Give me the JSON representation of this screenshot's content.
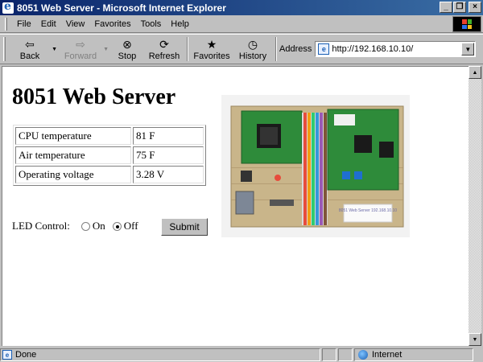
{
  "window": {
    "title": "8051 Web Server - Microsoft Internet Explorer",
    "minimize": "_",
    "restore": "❐",
    "close": "×"
  },
  "menu": {
    "file": "File",
    "edit": "Edit",
    "view": "View",
    "favorites": "Favorites",
    "tools": "Tools",
    "help": "Help"
  },
  "toolbar": {
    "back": "Back",
    "forward": "Forward",
    "stop": "Stop",
    "refresh": "Refresh",
    "favorites": "Favorites",
    "history": "History",
    "address_label": "Address",
    "url": "http://192.168.10.10/"
  },
  "page": {
    "title": "8051 Web Server",
    "readings": [
      {
        "label": "CPU temperature",
        "value": "81 F"
      },
      {
        "label": "Air temperature",
        "value": "75 F"
      },
      {
        "label": "Operating voltage",
        "value": "3.28 V"
      }
    ],
    "led_label": "LED Control:",
    "led_on": "On",
    "led_off": "Off",
    "led_selected": "Off",
    "submit": "Submit",
    "board_sticker": "8051 Web Server 192.168.10.10"
  },
  "status": {
    "text": "Done",
    "zone": "Internet"
  },
  "colors": {
    "titlebar_start": "#0a246a",
    "titlebar_end": "#3a6ea5",
    "chrome": "#c0c0c0",
    "pcb_green": "#2e8b3a"
  }
}
